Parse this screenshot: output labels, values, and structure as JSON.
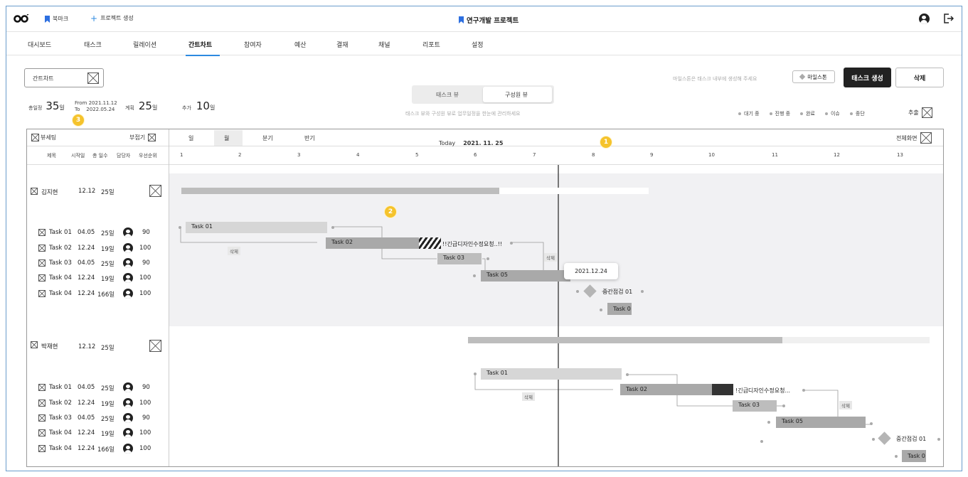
{
  "app": {
    "bookmark_label": "북마크",
    "create_project_label": "프로젝트 생성",
    "project_title": "연구개발 프로젝트"
  },
  "tabs": [
    "대시보드",
    "태스크",
    "릴레이션",
    "간트차트",
    "참여자",
    "예산",
    "결재",
    "채널",
    "리포트",
    "설정"
  ],
  "active_tab": "간트차트",
  "filter": {
    "label": "간트차트"
  },
  "summary": {
    "total_label": "총일정",
    "total_value": "35",
    "unit": "일",
    "from_label": "From",
    "from_date": "2021.11.12",
    "to_label": "To",
    "to_date": "2022.05.24",
    "plan_label": "계획",
    "plan_value": "25",
    "add_label": "추가",
    "add_value": "10"
  },
  "view_toggle": {
    "options": [
      "태스크 뷰",
      "구성원 뷰"
    ],
    "selected": "구성원 뷰",
    "hint": "태스크 뷰와 구성원 뷰로 업무일정을 한눈에 관리하세요"
  },
  "actions": {
    "milestone_hint": "마일스톤은 태스크 내부에 생성해 주세요",
    "milestone_label": "마일스톤",
    "create_task_label": "태스크 생성",
    "delete_label": "삭제"
  },
  "legend": {
    "items": [
      "대기 중",
      "진행 중",
      "완료",
      "이슈",
      "중단"
    ],
    "extract_label": "추출"
  },
  "gantt": {
    "view_setting_label": "뷰세팅",
    "collapse_label": "부접기",
    "scales": [
      "일",
      "월",
      "분기",
      "반기"
    ],
    "selected_scale": "월",
    "today_label": "Today",
    "today_date": "2021. 11. 25",
    "fullscreen_label": "전체화면",
    "columns": [
      "제목",
      "시작일",
      "총 일수",
      "담당자",
      "우선순위"
    ],
    "periods": [
      "1",
      "2",
      "3",
      "4",
      "5",
      "6",
      "7",
      "8",
      "9",
      "10",
      "11",
      "12",
      "13"
    ],
    "tooltip_date": "2021.12.24",
    "groups": [
      {
        "name": "김지현",
        "start": "12.12",
        "days": "25일",
        "tasks": [
          {
            "name": "Task 01",
            "start": "04.05",
            "days": "25일",
            "priority": "90"
          },
          {
            "name": "Task 02",
            "start": "12.24",
            "days": "19일",
            "priority": "100"
          },
          {
            "name": "Task 03",
            "start": "04.05",
            "days": "25일",
            "priority": "90"
          },
          {
            "name": "Task 04",
            "start": "12.24",
            "days": "19일",
            "priority": "100"
          },
          {
            "name": "Task 04",
            "start": "12.24",
            "days": "166일",
            "priority": "100"
          }
        ],
        "bars": {
          "t1": "Task 01",
          "t2": "Task 02",
          "t3": "Task 03",
          "t5": "Task 05",
          "issue": "!!긴급디자인수정요청..!!",
          "delete_tag": "삭제",
          "delete_tag2": "삭제",
          "milestone": "중간점검 01",
          "tail": "Task 0"
        }
      },
      {
        "name": "박재현",
        "start": "12.12",
        "days": "25일",
        "tasks": [
          {
            "name": "Task 01",
            "start": "04.05",
            "days": "25일",
            "priority": "90"
          },
          {
            "name": "Task 02",
            "start": "12.24",
            "days": "19일",
            "priority": "100"
          },
          {
            "name": "Task 03",
            "start": "04.05",
            "days": "25일",
            "priority": "90"
          },
          {
            "name": "Task 04",
            "start": "12.24",
            "days": "19일",
            "priority": "100"
          },
          {
            "name": "Task 04",
            "start": "12.24",
            "days": "166일",
            "priority": "100"
          }
        ],
        "bars": {
          "t1": "Task 01",
          "t2": "Task 02",
          "t3": "Task 03",
          "t5": "Task 05",
          "issue": "!긴급디자인수정요청...",
          "delete_tag": "삭제",
          "delete_tag2": "삭제",
          "milestone": "중간점검 01",
          "tail": "Task 0"
        }
      }
    ]
  },
  "badges": [
    "1",
    "2",
    "3"
  ],
  "colors": {
    "accent": "#2d8ae0",
    "badge": "#f5c32c",
    "bar_light": "#d6d6d6",
    "bar_mid": "#a9a9a9",
    "bar_dark": "#333333"
  }
}
